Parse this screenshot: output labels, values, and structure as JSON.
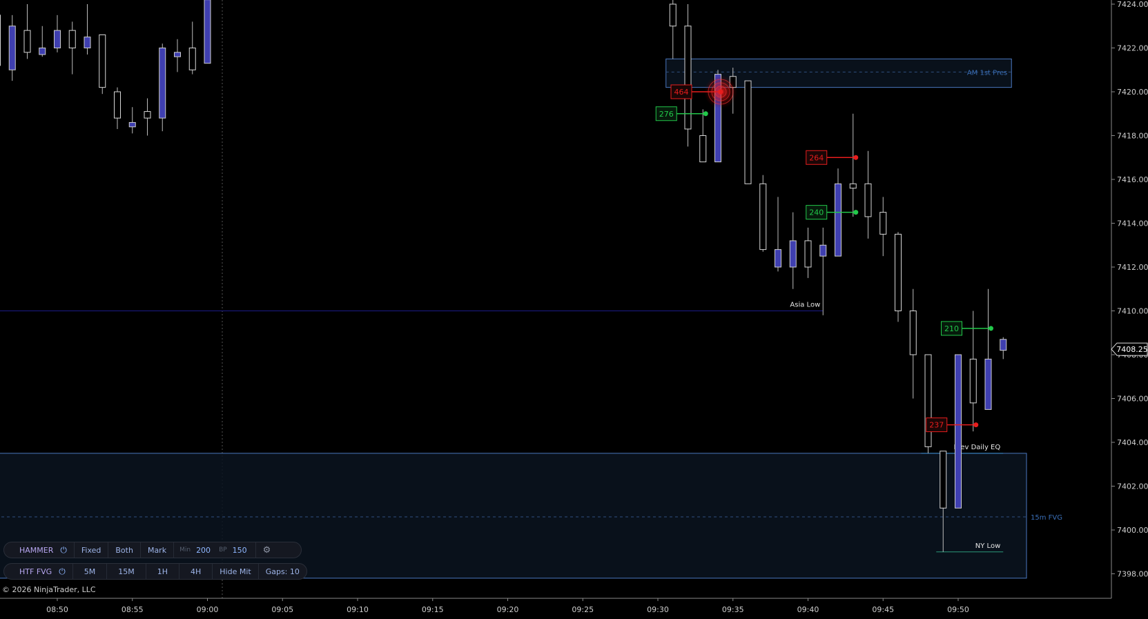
{
  "copyright": "© 2026 NinjaTrader, LLC",
  "colors": {
    "background": "#000000",
    "candle_up_outline": "#d8d8d8",
    "candle_down_fill": "#3f3fb0",
    "zone_border": "#4a78c0",
    "bullish_marker": "#22c84a",
    "bearish_marker": "#e81d1d",
    "asia_low_line": "#1b1b8a"
  },
  "price_axis": {
    "ticks": [
      "7424.00",
      "7422.00",
      "7420.00",
      "7418.00",
      "7416.00",
      "7414.00",
      "7412.00",
      "7410.00",
      "7408.00",
      "7406.00",
      "7404.00",
      "7402.00",
      "7400.00",
      "7398.00"
    ],
    "current_price": "7408.25"
  },
  "time_axis": {
    "ticks": [
      "08:50",
      "08:55",
      "09:00",
      "09:05",
      "09:10",
      "09:15",
      "09:20",
      "09:25",
      "09:30",
      "09:35",
      "09:40",
      "09:45",
      "09:50"
    ]
  },
  "candles": [
    {
      "t": "08:46",
      "o": 7421.2,
      "h": 7423.8,
      "l": 7421.0,
      "c": 7423.5
    },
    {
      "t": "08:47",
      "o": 7423.0,
      "h": 7423.5,
      "l": 7420.5,
      "c": 7421.0
    },
    {
      "t": "08:48",
      "o": 7421.8,
      "h": 7424.0,
      "l": 7421.5,
      "c": 7422.8
    },
    {
      "t": "08:49",
      "o": 7422.0,
      "h": 7423.0,
      "l": 7421.6,
      "c": 7421.7
    },
    {
      "t": "08:50",
      "o": 7422.8,
      "h": 7423.5,
      "l": 7421.8,
      "c": 7422.0
    },
    {
      "t": "08:51",
      "o": 7422.0,
      "h": 7423.2,
      "l": 7420.8,
      "c": 7422.8
    },
    {
      "t": "08:52",
      "o": 7422.5,
      "h": 7424.0,
      "l": 7421.7,
      "c": 7422.0
    },
    {
      "t": "08:53",
      "o": 7420.2,
      "h": 7422.6,
      "l": 7419.9,
      "c": 7422.6
    },
    {
      "t": "08:54",
      "o": 7418.8,
      "h": 7420.2,
      "l": 7418.3,
      "c": 7420.0
    },
    {
      "t": "08:55",
      "o": 7418.6,
      "h": 7419.3,
      "l": 7418.1,
      "c": 7418.4
    },
    {
      "t": "08:56",
      "o": 7418.8,
      "h": 7419.7,
      "l": 7418.0,
      "c": 7419.1
    },
    {
      "t": "08:57",
      "o": 7422.0,
      "h": 7422.2,
      "l": 7418.2,
      "c": 7418.8
    },
    {
      "t": "08:58",
      "o": 7421.8,
      "h": 7422.4,
      "l": 7420.9,
      "c": 7421.6
    },
    {
      "t": "08:59",
      "o": 7421.0,
      "h": 7423.2,
      "l": 7420.8,
      "c": 7422.0
    },
    {
      "t": "09:00",
      "o": 7424.2,
      "h": 7424.5,
      "l": 7421.3,
      "c": 7421.3
    },
    {
      "t": "09:31",
      "o": 7423.0,
      "h": 7424.5,
      "l": 7421.5,
      "c": 7424.0
    },
    {
      "t": "09:32",
      "o": 7418.3,
      "h": 7424.0,
      "l": 7417.5,
      "c": 7423.0
    },
    {
      "t": "09:33",
      "o": 7416.8,
      "h": 7419.2,
      "l": 7416.8,
      "c": 7418.0
    },
    {
      "t": "09:34",
      "o": 7420.8,
      "h": 7421.0,
      "l": 7416.8,
      "c": 7416.8
    },
    {
      "t": "09:35",
      "o": 7420.2,
      "h": 7421.1,
      "l": 7419.0,
      "c": 7420.7
    },
    {
      "t": "09:36",
      "o": 7415.8,
      "h": 7420.5,
      "l": 7415.8,
      "c": 7420.5
    },
    {
      "t": "09:37",
      "o": 7412.8,
      "h": 7416.2,
      "l": 7412.7,
      "c": 7415.8
    },
    {
      "t": "09:38",
      "o": 7412.8,
      "h": 7415.2,
      "l": 7411.8,
      "c": 7412.0
    },
    {
      "t": "09:39",
      "o": 7413.2,
      "h": 7414.5,
      "l": 7411.0,
      "c": 7412.0
    },
    {
      "t": "09:40",
      "o": 7412.0,
      "h": 7413.8,
      "l": 7411.5,
      "c": 7413.2
    },
    {
      "t": "09:41",
      "o": 7413.0,
      "h": 7413.8,
      "l": 7409.8,
      "c": 7412.5
    },
    {
      "t": "09:42",
      "o": 7415.8,
      "h": 7416.5,
      "l": 7412.5,
      "c": 7412.5
    },
    {
      "t": "09:43",
      "o": 7415.6,
      "h": 7419.0,
      "l": 7414.3,
      "c": 7415.8
    },
    {
      "t": "09:44",
      "o": 7414.3,
      "h": 7417.3,
      "l": 7413.3,
      "c": 7415.8
    },
    {
      "t": "09:45",
      "o": 7413.5,
      "h": 7415.2,
      "l": 7412.5,
      "c": 7414.5
    },
    {
      "t": "09:46",
      "o": 7410.0,
      "h": 7413.6,
      "l": 7409.5,
      "c": 7413.5
    },
    {
      "t": "09:47",
      "o": 7408.0,
      "h": 7411.0,
      "l": 7406.0,
      "c": 7410.0
    },
    {
      "t": "09:48",
      "o": 7403.8,
      "h": 7408.0,
      "l": 7403.5,
      "c": 7408.0
    },
    {
      "t": "09:49",
      "o": 7401.0,
      "h": 7403.6,
      "l": 7399.0,
      "c": 7403.6
    },
    {
      "t": "09:50",
      "o": 7408.0,
      "h": 7408.0,
      "l": 7401.0,
      "c": 7401.0
    },
    {
      "t": "09:51",
      "o": 7405.8,
      "h": 7410.0,
      "l": 7404.5,
      "c": 7407.8
    },
    {
      "t": "09:52",
      "o": 7407.8,
      "h": 7411.0,
      "l": 7405.5,
      "c": 7405.5
    },
    {
      "t": "09:53",
      "o": 7408.7,
      "h": 7408.8,
      "l": 7407.8,
      "c": 7408.2
    }
  ],
  "zones": [
    {
      "name": "AM 1st Pres",
      "label": "AM 1st Pres",
      "start": "09:31",
      "end": "09:53",
      "top": 7421.5,
      "bottom": 7420.2,
      "mid": 7420.9
    },
    {
      "name": "15m FVG",
      "label": "15m FVG",
      "start": "08:46",
      "end": "09:54",
      "top": 7403.5,
      "bottom": 7397.8,
      "mid": 7400.6
    }
  ],
  "levels": [
    {
      "name": "Asia Low",
      "label": "Asia Low",
      "start": "08:46",
      "end": "09:41",
      "price": 7410.0
    },
    {
      "name": "Prev Daily EQ",
      "label": "Prev Daily EQ",
      "start": "09:48",
      "end": "09:53",
      "price": 7403.5
    },
    {
      "name": "NY Low",
      "label": "NY Low",
      "start": "09:49",
      "end": "09:53",
      "price": 7399.0
    }
  ],
  "markers": [
    {
      "value": "464",
      "type": "bearish",
      "time": "09:34",
      "price": 7420.0,
      "highlight": true
    },
    {
      "value": "276",
      "type": "bullish",
      "time": "09:33",
      "price": 7419.0
    },
    {
      "value": "264",
      "type": "bearish",
      "time": "09:43",
      "price": 7417.0
    },
    {
      "value": "240",
      "type": "bullish",
      "time": "09:43",
      "price": 7414.5
    },
    {
      "value": "210",
      "type": "bullish",
      "time": "09:52",
      "price": 7409.2
    },
    {
      "value": "237",
      "type": "bearish",
      "time": "09:51",
      "price": 7404.8
    }
  ],
  "toolbar_hammer": {
    "title": "HAMMER",
    "power_icon": "power-icon",
    "mode": "Fixed",
    "direction": "Both",
    "display": "Mark",
    "min_label": "Min",
    "min_value": "200",
    "bp_label": "BP",
    "bp_value": "150",
    "settings_icon": "gear-icon"
  },
  "toolbar_htf": {
    "title": "HTF FVG",
    "power_icon": "power-icon",
    "tf_5m": "5M",
    "tf_15m": "15M",
    "tf_1h": "1H",
    "tf_4h": "4H",
    "hide_mit": "Hide Mit",
    "gaps": "Gaps: 10"
  }
}
